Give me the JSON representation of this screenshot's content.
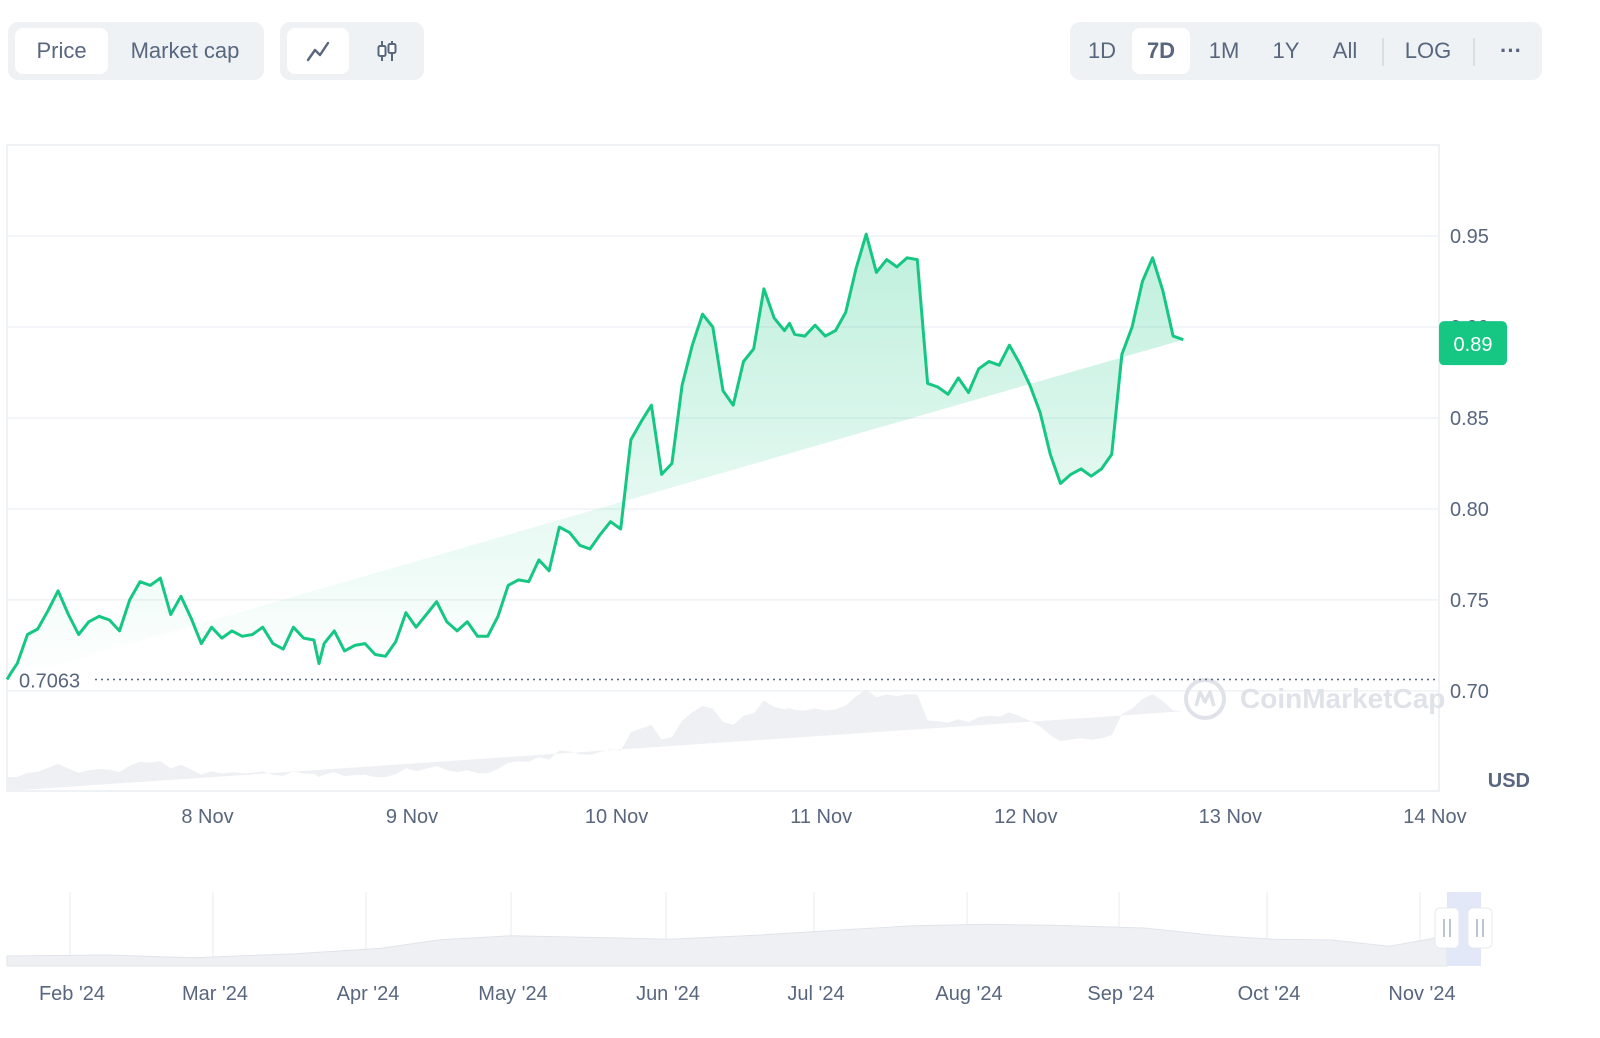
{
  "controls": {
    "mode_tabs": [
      {
        "label": "Price",
        "active": true
      },
      {
        "label": "Market cap",
        "active": false
      }
    ],
    "chart_type_icons": [
      "line-chart-icon",
      "candlestick-icon"
    ],
    "range_tabs": [
      {
        "label": "1D",
        "active": false
      },
      {
        "label": "7D",
        "active": true
      },
      {
        "label": "1M",
        "active": false
      },
      {
        "label": "1Y",
        "active": false
      },
      {
        "label": "All",
        "active": false
      }
    ],
    "log_label": "LOG",
    "more_label": "···"
  },
  "chart_data": {
    "type": "area",
    "title": "",
    "currency": "USD",
    "watermark": "CoinMarketCap",
    "x_ticks": [
      "8 Nov",
      "9 Nov",
      "10 Nov",
      "11 Nov",
      "12 Nov",
      "13 Nov",
      "14 Nov"
    ],
    "y_ticks": [
      "0.70",
      "0.75",
      "0.80",
      "0.85",
      "0.90",
      "0.95"
    ],
    "ylim": [
      0.645,
      1.0
    ],
    "open_price": "0.7063",
    "current_price": "0.89",
    "colors": {
      "line": "#16c784",
      "fill_top": "#16c784",
      "volume": "#eef0f4",
      "badge": "#16c784"
    },
    "x_days": [
      0,
      0.04,
      0.1,
      0.2,
      0.3,
      0.4,
      0.5,
      0.6,
      0.7,
      0.8,
      0.9,
      1.0,
      1.1,
      1.2,
      1.3,
      1.4,
      1.5,
      1.6,
      1.7,
      1.8,
      1.9,
      2.0,
      2.1,
      2.2,
      2.3,
      2.4,
      2.5,
      2.6,
      2.7,
      2.8,
      2.9,
      3.0,
      3.05,
      3.1,
      3.2,
      3.3,
      3.4,
      3.5,
      3.6,
      3.7,
      3.8,
      3.9,
      4.0,
      4.1,
      4.2,
      4.3,
      4.4,
      4.5,
      4.6,
      4.7,
      4.8,
      4.9,
      5.0,
      5.1,
      5.2,
      5.3,
      5.4,
      5.5,
      5.6,
      5.7,
      5.8,
      5.9,
      6.0,
      6.1,
      6.2,
      6.3,
      6.4,
      6.5,
      6.6,
      6.7,
      6.8,
      6.9,
      7.0,
      7.1,
      7.2,
      7.3,
      7.4,
      7.5,
      7.6,
      7.65,
      7.7,
      7.8,
      7.9,
      8.0,
      8.1,
      8.2,
      8.3,
      8.4,
      8.5,
      8.6,
      8.7,
      8.8,
      8.9,
      9.0,
      9.1,
      9.2,
      9.3,
      9.4,
      9.5,
      9.6,
      9.7,
      9.8,
      9.9,
      10.0,
      10.1,
      10.2,
      10.3,
      10.4,
      10.5,
      10.6,
      10.7,
      10.8,
      10.9,
      11.0,
      11.1,
      11.2,
      11.3,
      11.4,
      11.5,
      11.6,
      11.7,
      11.8,
      11.9,
      12.0,
      12.1,
      12.2,
      12.3,
      12.4,
      12.5,
      12.6,
      12.7,
      12.8,
      12.9,
      13.0,
      13.1
    ],
    "prices": [
      0.7063,
      0.71,
      0.715,
      0.731,
      0.734,
      0.744,
      0.755,
      0.742,
      0.731,
      0.738,
      0.741,
      0.739,
      0.733,
      0.75,
      0.76,
      0.758,
      0.762,
      0.742,
      0.752,
      0.74,
      0.726,
      0.735,
      0.729,
      0.733,
      0.73,
      0.731,
      0.735,
      0.726,
      0.723,
      0.735,
      0.729,
      0.728,
      0.715,
      0.726,
      0.733,
      0.722,
      0.725,
      0.726,
      0.72,
      0.719,
      0.727,
      0.743,
      0.735,
      0.742,
      0.749,
      0.738,
      0.733,
      0.738,
      0.73,
      0.73,
      0.741,
      0.758,
      0.761,
      0.76,
      0.772,
      0.766,
      0.79,
      0.787,
      0.78,
      0.778,
      0.786,
      0.793,
      0.789,
      0.838,
      0.848,
      0.857,
      0.819,
      0.825,
      0.868,
      0.89,
      0.907,
      0.9,
      0.865,
      0.857,
      0.881,
      0.888,
      0.921,
      0.905,
      0.898,
      0.902,
      0.896,
      0.895,
      0.901,
      0.895,
      0.898,
      0.908,
      0.932,
      0.951,
      0.93,
      0.937,
      0.933,
      0.938,
      0.937,
      0.869,
      0.867,
      0.863,
      0.872,
      0.864,
      0.877,
      0.881,
      0.879,
      0.89,
      0.88,
      0.868,
      0.853,
      0.83,
      0.814,
      0.819,
      0.822,
      0.818,
      0.822,
      0.83,
      0.885,
      0.9,
      0.925,
      0.938,
      0.92,
      0.895,
      0.893
    ],
    "overview_x_ticks": [
      "Feb '24",
      "Mar '24",
      "Apr '24",
      "May '24",
      "Jun '24",
      "Jul '24",
      "Aug '24",
      "Sep '24",
      "Oct '24",
      "Nov '24"
    ]
  }
}
